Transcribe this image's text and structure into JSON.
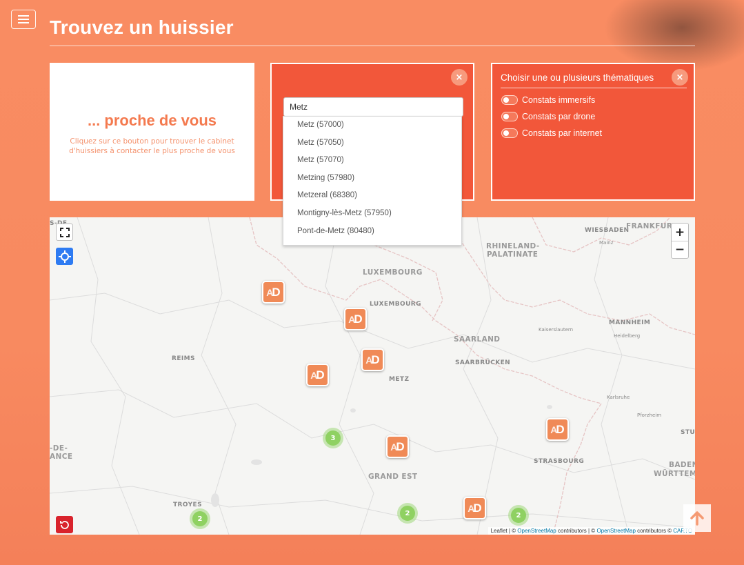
{
  "page": {
    "title": "Trouvez un huissier"
  },
  "near_card": {
    "title": "... proche de vous",
    "description": "Cliquez sur ce bouton pour trouver le cabinet d'huissiers à contacter le plus proche de vous"
  },
  "search_card": {
    "input_value": "Metz",
    "close_label": "×",
    "suggestions": [
      "Metz (57000)",
      "Metz (57050)",
      "Metz (57070)",
      "Metzing (57980)",
      "Metzeral (68380)",
      "Montigny-lès-Metz (57950)",
      "Pont-de-Metz (80480)"
    ]
  },
  "themes_card": {
    "title": "Choisir une ou plusieurs thématiques",
    "close_label": "×",
    "options": [
      "Constats immersifs",
      "Constats par drone",
      "Constats par internet"
    ]
  },
  "map": {
    "labels": {
      "wiesbaden": "WIESBADEN",
      "frankfurt": "FRANKFURT",
      "mainz": "Mainz",
      "rhineland": "RHINELAND-",
      "palatinate": "PALATINATE",
      "luxembourg_region": "LUXEMBOURG",
      "luxembourg_city": "LUXEMBOURG",
      "saarland": "SAARLAND",
      "saarbrucken": "SAARBRÜCKEN",
      "kaiserslautern": "Kaiserslautern",
      "mannheim": "MANNHEIM",
      "heidelberg": "Heidelberg",
      "reims": "REIMS",
      "metz": "METZ",
      "karlsruhe": "Karlsruhe",
      "pforzheim": "Pforzheim",
      "stu": "STU",
      "strasbourg": "STRASBOURG",
      "baden": "BADEN",
      "wurttem": "WÜRTTEM",
      "grand_est": "GRAND EST",
      "troyes": "TROYES",
      "rde": "-DE-",
      "ance": "ANCE",
      "sde": "S-DE"
    },
    "clusters": [
      "3",
      "2",
      "2",
      "2"
    ],
    "marker_text": {
      "a": "A",
      "d": "D"
    },
    "zoom_in": "+",
    "zoom_out": "−",
    "attribution": {
      "leaflet": "Leaflet | © ",
      "osm1": "OpenStreetMap",
      "contrib1": " contributors | © ",
      "osm2": "OpenStreetMap",
      "contrib2": " contributors © ",
      "carto": "CARTO"
    }
  },
  "icons": {
    "menu": "hamburger-icon",
    "close": "close-icon",
    "fullscreen": "fullscreen-icon",
    "locate": "locate-icon",
    "reset": "reset-icon",
    "scroll_top": "arrow-up-icon"
  },
  "colors": {
    "background": "#f98c62",
    "card_accent": "#f2573a",
    "marker": "#f08a57",
    "cluster": "#8fd162"
  }
}
